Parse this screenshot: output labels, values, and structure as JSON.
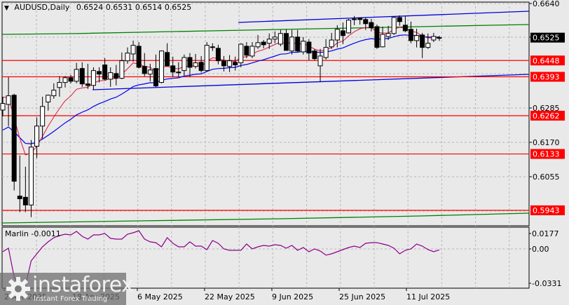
{
  "header": {
    "symbol": "AUDUSD,Daily",
    "open": "0.6524",
    "high": "0.6531",
    "low": "0.6514",
    "close": "0.6525"
  },
  "indicator": {
    "name": "Marlin",
    "value": "-0.0011"
  },
  "logo": {
    "name": "instaforex",
    "tagline": "Instant Forex Trading"
  },
  "colors": {
    "bull": "#ffffff",
    "bear": "#000000",
    "fast_ma": "#e0143c",
    "slow_ma": "#0000ee",
    "levels": "#ff0000",
    "channel_green": "#008000",
    "channel_blue": "#0000dd",
    "oscillator": "#8b008b",
    "current_price_bg": "#000000"
  },
  "chart_data": {
    "type": "candlestick",
    "symbol": "AUDUSD",
    "timeframe": "Daily",
    "price_axis": {
      "ylim": [
        0.5915,
        0.6652
      ],
      "ticks": [
        "0.6640",
        "0.6525",
        "0.6285",
        "0.6170",
        "0.6055"
      ]
    },
    "current_price": "0.6525",
    "levels": [
      "0.6448",
      "0.6393",
      "0.6262",
      "0.6133",
      "0.5943"
    ],
    "date_ticks": [
      "2 Apr 2025",
      "18 Apr 2025",
      "6 May 2025",
      "22 May 2025",
      "9 Jun 2025",
      "25 Jun 2025",
      "11 Jul 2025"
    ],
    "ohlc": [
      [
        0.6281,
        0.6326,
        0.626,
        0.6303
      ],
      [
        0.63,
        0.6392,
        0.6227,
        0.6329
      ],
      [
        0.6331,
        0.6336,
        0.601,
        0.6041
      ],
      [
        0.5991,
        0.6128,
        0.5937,
        0.5982
      ],
      [
        0.5987,
        0.609,
        0.5937,
        0.5961
      ],
      [
        0.5961,
        0.618,
        0.592,
        0.6156
      ],
      [
        0.6159,
        0.6256,
        0.6119,
        0.6227
      ],
      [
        0.6227,
        0.6326,
        0.6185,
        0.6293
      ],
      [
        0.6308,
        0.6333,
        0.6279,
        0.6331
      ],
      [
        0.6329,
        0.6371,
        0.6319,
        0.6348
      ],
      [
        0.6357,
        0.6395,
        0.6326,
        0.6374
      ],
      [
        0.6374,
        0.6395,
        0.6357,
        0.639
      ],
      [
        0.639,
        0.6399,
        0.6371,
        0.6378
      ],
      [
        0.6378,
        0.644,
        0.6371,
        0.6418
      ],
      [
        0.6421,
        0.6442,
        0.6359,
        0.6369
      ],
      [
        0.6369,
        0.6437,
        0.6352,
        0.6364
      ],
      [
        0.6364,
        0.6425,
        0.635,
        0.6414
      ],
      [
        0.6411,
        0.6425,
        0.6374,
        0.6402
      ],
      [
        0.6433,
        0.6456,
        0.6381,
        0.6385
      ],
      [
        0.6385,
        0.6425,
        0.6359,
        0.6407
      ],
      [
        0.6404,
        0.6433,
        0.6364,
        0.6388
      ],
      [
        0.6388,
        0.6475,
        0.6385,
        0.6447
      ],
      [
        0.6447,
        0.6492,
        0.6437,
        0.6473
      ],
      [
        0.647,
        0.6515,
        0.6444,
        0.6499
      ],
      [
        0.6496,
        0.651,
        0.6421,
        0.6425
      ],
      [
        0.6428,
        0.6473,
        0.6395,
        0.6404
      ],
      [
        0.6402,
        0.6437,
        0.6378,
        0.6416
      ],
      [
        0.6421,
        0.6468,
        0.6359,
        0.6362
      ],
      [
        0.6374,
        0.6482,
        0.6371,
        0.648
      ],
      [
        0.6475,
        0.6506,
        0.6428,
        0.643
      ],
      [
        0.643,
        0.6461,
        0.6392,
        0.6409
      ],
      [
        0.6409,
        0.6442,
        0.6392,
        0.6407
      ],
      [
        0.6414,
        0.6468,
        0.6397,
        0.6458
      ],
      [
        0.6458,
        0.6473,
        0.6392,
        0.6425
      ],
      [
        0.6428,
        0.647,
        0.6421,
        0.644
      ],
      [
        0.6442,
        0.6463,
        0.6407,
        0.6414
      ],
      [
        0.6414,
        0.651,
        0.6411,
        0.6499
      ],
      [
        0.6492,
        0.6506,
        0.648,
        0.6494
      ],
      [
        0.6489,
        0.6501,
        0.6435,
        0.6447
      ],
      [
        0.6447,
        0.6463,
        0.6411,
        0.643
      ],
      [
        0.6428,
        0.6466,
        0.6409,
        0.6447
      ],
      [
        0.6442,
        0.6461,
        0.6414,
        0.6433
      ],
      [
        0.644,
        0.6506,
        0.6425,
        0.6503
      ],
      [
        0.6496,
        0.651,
        0.6456,
        0.6466
      ],
      [
        0.6463,
        0.651,
        0.6456,
        0.6496
      ],
      [
        0.6494,
        0.6534,
        0.6487,
        0.6508
      ],
      [
        0.651,
        0.6517,
        0.6489,
        0.6501
      ],
      [
        0.6506,
        0.6539,
        0.6487,
        0.652
      ],
      [
        0.652,
        0.6546,
        0.6506,
        0.6527
      ],
      [
        0.6503,
        0.6551,
        0.6496,
        0.6539
      ],
      [
        0.6539,
        0.6553,
        0.6482,
        0.6482
      ],
      [
        0.648,
        0.6551,
        0.6468,
        0.6527
      ],
      [
        0.6527,
        0.6551,
        0.6475,
        0.648
      ],
      [
        0.6477,
        0.6527,
        0.6468,
        0.6513
      ],
      [
        0.651,
        0.652,
        0.6449,
        0.6473
      ],
      [
        0.648,
        0.6487,
        0.6449,
        0.6454
      ],
      [
        0.643,
        0.6487,
        0.6376,
        0.6463
      ],
      [
        0.6458,
        0.652,
        0.6451,
        0.6492
      ],
      [
        0.6494,
        0.6541,
        0.6487,
        0.6517
      ],
      [
        0.6517,
        0.6567,
        0.6492,
        0.6553
      ],
      [
        0.6548,
        0.6576,
        0.6503,
        0.6532
      ],
      [
        0.6541,
        0.6588,
        0.6539,
        0.6584
      ],
      [
        0.6588,
        0.6598,
        0.6567,
        0.6586
      ],
      [
        0.6591,
        0.6593,
        0.6569,
        0.6586
      ],
      [
        0.6586,
        0.6593,
        0.6551,
        0.6572
      ],
      [
        0.6576,
        0.6588,
        0.6546,
        0.6558
      ],
      [
        0.6562,
        0.6569,
        0.6487,
        0.6492
      ],
      [
        0.6494,
        0.6562,
        0.6492,
        0.6536
      ],
      [
        0.6529,
        0.6565,
        0.6517,
        0.6539
      ],
      [
        0.6539,
        0.6595,
        0.6534,
        0.6593
      ],
      [
        0.6593,
        0.66,
        0.6565,
        0.6579
      ],
      [
        0.6567,
        0.6598,
        0.6543,
        0.6548
      ],
      [
        0.6553,
        0.6579,
        0.6506,
        0.6515
      ],
      [
        0.6515,
        0.6555,
        0.6492,
        0.6532
      ],
      [
        0.6534,
        0.6541,
        0.6456,
        0.6492
      ],
      [
        0.6492,
        0.6539,
        0.6487,
        0.6506
      ],
      [
        0.6517,
        0.6541,
        0.651,
        0.6529
      ],
      [
        0.6524,
        0.6531,
        0.6514,
        0.6525
      ]
    ],
    "oscillator": {
      "name": "Marlin",
      "ylim": [
        -0.0331,
        0.0177
      ],
      "ticks": [
        "0.0177",
        "0.00",
        "-0.0331"
      ],
      "values": [
        -0.0032,
        0.0008,
        -0.0322,
        -0.045,
        -0.0427,
        -0.0137,
        -0.0056,
        0.0024,
        0.0081,
        0.0129,
        0.0153,
        0.0169,
        0.0161,
        0.0201,
        0.0145,
        0.0113,
        0.0161,
        0.0161,
        0.0177,
        0.0121,
        0.0113,
        0.0113,
        0.0169,
        0.0185,
        0.0209,
        0.0113,
        0.0081,
        0.0072,
        0.0024,
        0.0129,
        0.0064,
        0.0024,
        0.0024,
        0.0081,
        0.0032,
        0.0032,
        -0.0008,
        0.0097,
        0.0064,
        0.0,
        -0.0016,
        -0.0016,
        -0.0016,
        0.0056,
        0.0,
        0.0024,
        0.004,
        0.0032,
        0.0048,
        0.004,
        0.0008,
        0.004,
        -0.0016,
        0.0016,
        -0.0032,
        0.0,
        -0.0024,
        -0.0072,
        -0.0056,
        -0.0032,
        -0.0008,
        0.0016,
        0.0032,
        0.0016,
        0.0064,
        0.0072,
        0.0072,
        0.0056,
        0.004,
        0.0008,
        -0.0056,
        -0.0016,
        0.0,
        0.0056,
        0.0032,
        -0.0008,
        -0.0032,
        -0.0011
      ]
    }
  }
}
